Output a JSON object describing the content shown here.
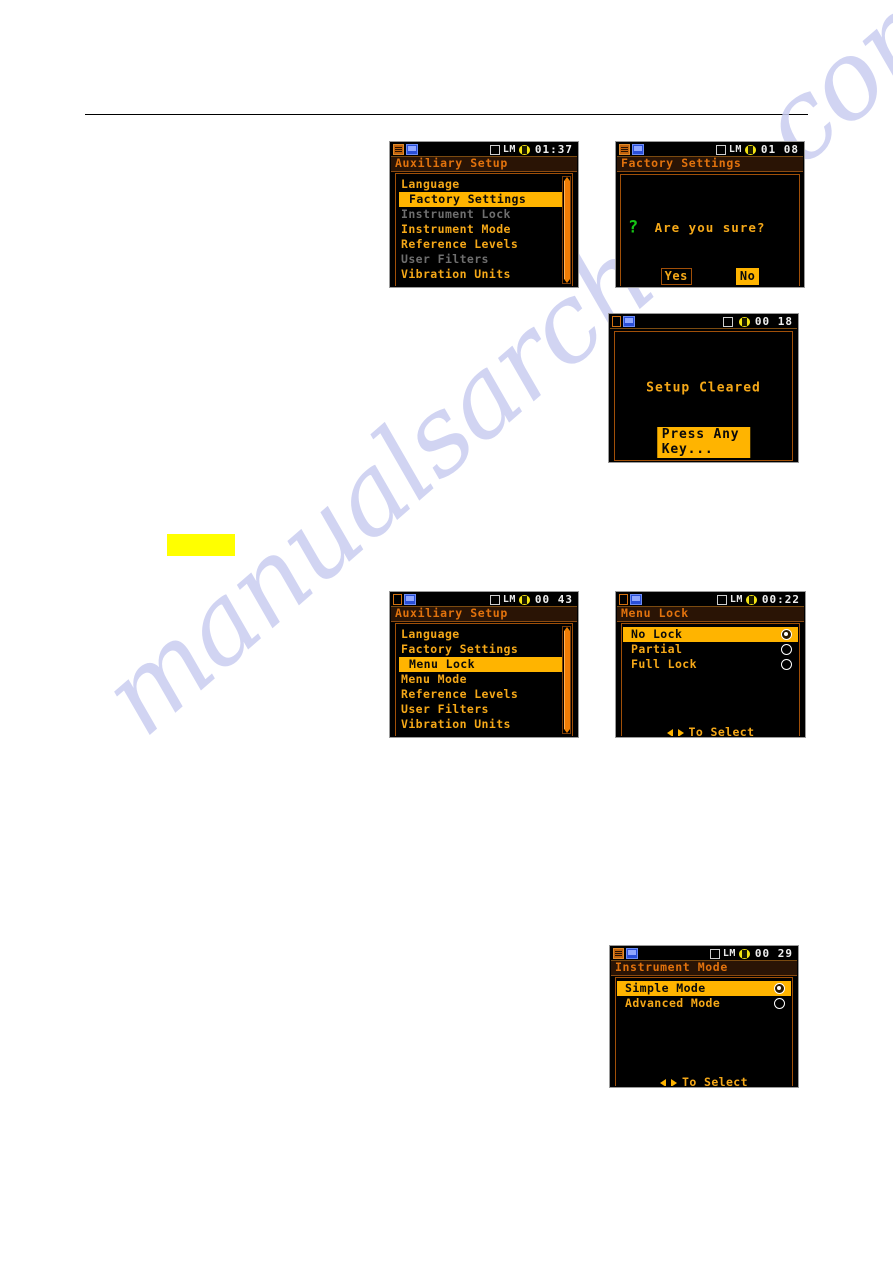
{
  "page": {
    "watermark_text": "manualsarchive.com",
    "redaction_label": ""
  },
  "screens": {
    "aux_setup_1": {
      "statusbar": {
        "icon_left_1": "sd-card-icon",
        "icon_left_2": "monitor-icon",
        "icon_checkbox": "square-checkbox-icon",
        "mode_label": "LM",
        "battery_icon": "battery-icon",
        "time": "01:37"
      },
      "title": "Auxiliary Setup",
      "items": [
        {
          "label": "Language",
          "state": "normal"
        },
        {
          "label": "Factory Settings",
          "state": "selected"
        },
        {
          "label": "Instrument Lock",
          "state": "disabled"
        },
        {
          "label": "Instrument Mode",
          "state": "normal"
        },
        {
          "label": "Reference Levels",
          "state": "normal"
        },
        {
          "label": "User Filters",
          "state": "disabled"
        },
        {
          "label": "Vibration Units",
          "state": "normal"
        }
      ],
      "scrollbar": {
        "up_arrow": "scroll-up-arrow-icon",
        "down_arrow": "scroll-down-arrow-icon"
      }
    },
    "factory_settings_confirm": {
      "statusbar": {
        "icon_left_1": "sd-card-icon",
        "icon_left_2": "monitor-icon",
        "icon_checkbox": "square-checkbox-icon",
        "mode_label": "LM",
        "battery_icon": "battery-icon",
        "time": "01 08"
      },
      "title": "Factory Settings",
      "question_icon": "question-mark-icon",
      "question": "Are you sure?",
      "buttons": [
        {
          "label": "Yes",
          "style": "outlined"
        },
        {
          "label": "No",
          "style": "filled"
        }
      ]
    },
    "setup_cleared": {
      "statusbar": {
        "icon_left_1": "file-icon",
        "icon_left_2": "monitor-icon",
        "icon_checkbox": "square-checkbox-icon",
        "mode_label": "",
        "battery_icon": "battery-icon",
        "time": "00 18"
      },
      "title": "",
      "message": "Setup Cleared",
      "action": "Press Any Key..."
    },
    "aux_setup_2": {
      "statusbar": {
        "icon_left_1": "file-icon",
        "icon_left_2": "monitor-icon",
        "icon_checkbox": "square-checkbox-icon",
        "mode_label": "LM",
        "battery_icon": "battery-icon",
        "time": "00 43"
      },
      "title": "Auxiliary Setup",
      "items": [
        {
          "label": "Language",
          "state": "normal"
        },
        {
          "label": "Factory Settings",
          "state": "normal"
        },
        {
          "label": "Menu Lock",
          "state": "selected"
        },
        {
          "label": "Menu Mode",
          "state": "normal"
        },
        {
          "label": "Reference Levels",
          "state": "normal"
        },
        {
          "label": "User Filters",
          "state": "normal"
        },
        {
          "label": "Vibration Units",
          "state": "normal"
        }
      ],
      "scrollbar": {
        "up_arrow": "scroll-up-arrow-icon",
        "down_arrow": "scroll-down-arrow-icon"
      }
    },
    "menu_lock": {
      "statusbar": {
        "icon_left_1": "file-icon",
        "icon_left_2": "monitor-icon",
        "icon_checkbox": "square-checkbox-icon",
        "mode_label": "LM",
        "battery_icon": "battery-icon",
        "time": "00:22"
      },
      "title": "Menu Lock",
      "options": [
        {
          "label": "No Lock",
          "selected": true
        },
        {
          "label": "Partial",
          "selected": false
        },
        {
          "label": "Full Lock",
          "selected": false
        }
      ],
      "hint": "To Select",
      "hint_left_icon": "left-triangle-icon",
      "hint_right_icon": "right-triangle-icon"
    },
    "instrument_mode": {
      "statusbar": {
        "icon_left_1": "sd-card-icon",
        "icon_left_2": "monitor-icon",
        "icon_checkbox": "square-checkbox-icon",
        "mode_label": "LM",
        "battery_icon": "battery-icon",
        "time": "00 29"
      },
      "title": "Instrument Mode",
      "options": [
        {
          "label": "Simple Mode",
          "selected": true
        },
        {
          "label": "Advanced Mode",
          "selected": false
        }
      ],
      "hint": "To Select",
      "hint_left_icon": "left-triangle-icon",
      "hint_right_icon": "right-triangle-icon"
    }
  },
  "colors": {
    "accent_orange": "#f5a818",
    "highlight": "#ffb400",
    "title_orange": "#e1720d",
    "frame_orange": "#a04f08",
    "disabled_gray": "#6e6e6e",
    "watermark": "#c9cdf0",
    "redaction_yellow": "#ffff00",
    "lcd_background": "#000000"
  }
}
